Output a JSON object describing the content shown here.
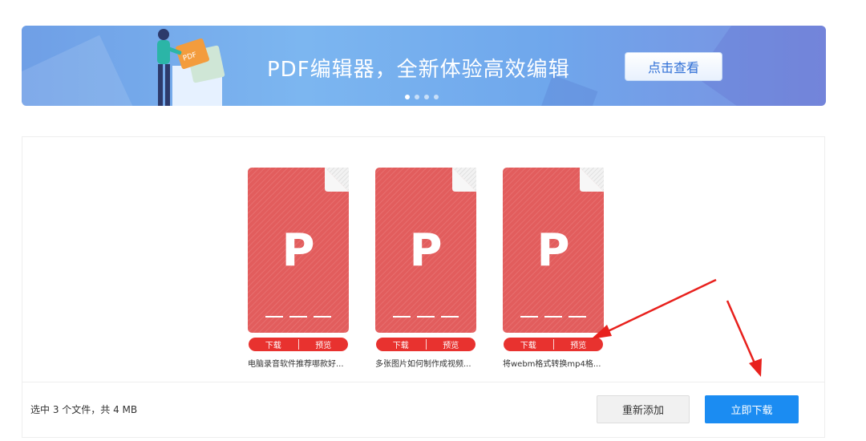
{
  "banner": {
    "title": "PDF编辑器，全新体验高效编辑",
    "cta_label": "点击查看",
    "illustration_badge": "PDF",
    "carousel_dot_count": 4,
    "active_dot": 1
  },
  "files": [
    {
      "letter": "P",
      "download_label": "下载",
      "preview_label": "预览",
      "name": "电脑录音软件推荐哪款好..."
    },
    {
      "letter": "P",
      "download_label": "下载",
      "preview_label": "预览",
      "name": "多张图片如何制作成视频..."
    },
    {
      "letter": "P",
      "download_label": "下载",
      "preview_label": "预览",
      "name": "将webm格式转换mp4格..."
    }
  ],
  "footer": {
    "summary": "选中 3 个文件，共 4 MB",
    "readd_label": "重新添加",
    "download_all_label": "立即下载"
  },
  "colors": {
    "banner_accent": "#7cb6f0",
    "file_red": "#e25d5d",
    "action_red": "#e8322f",
    "primary_blue": "#1b8cf2",
    "arrow_red": "#e8211d"
  }
}
